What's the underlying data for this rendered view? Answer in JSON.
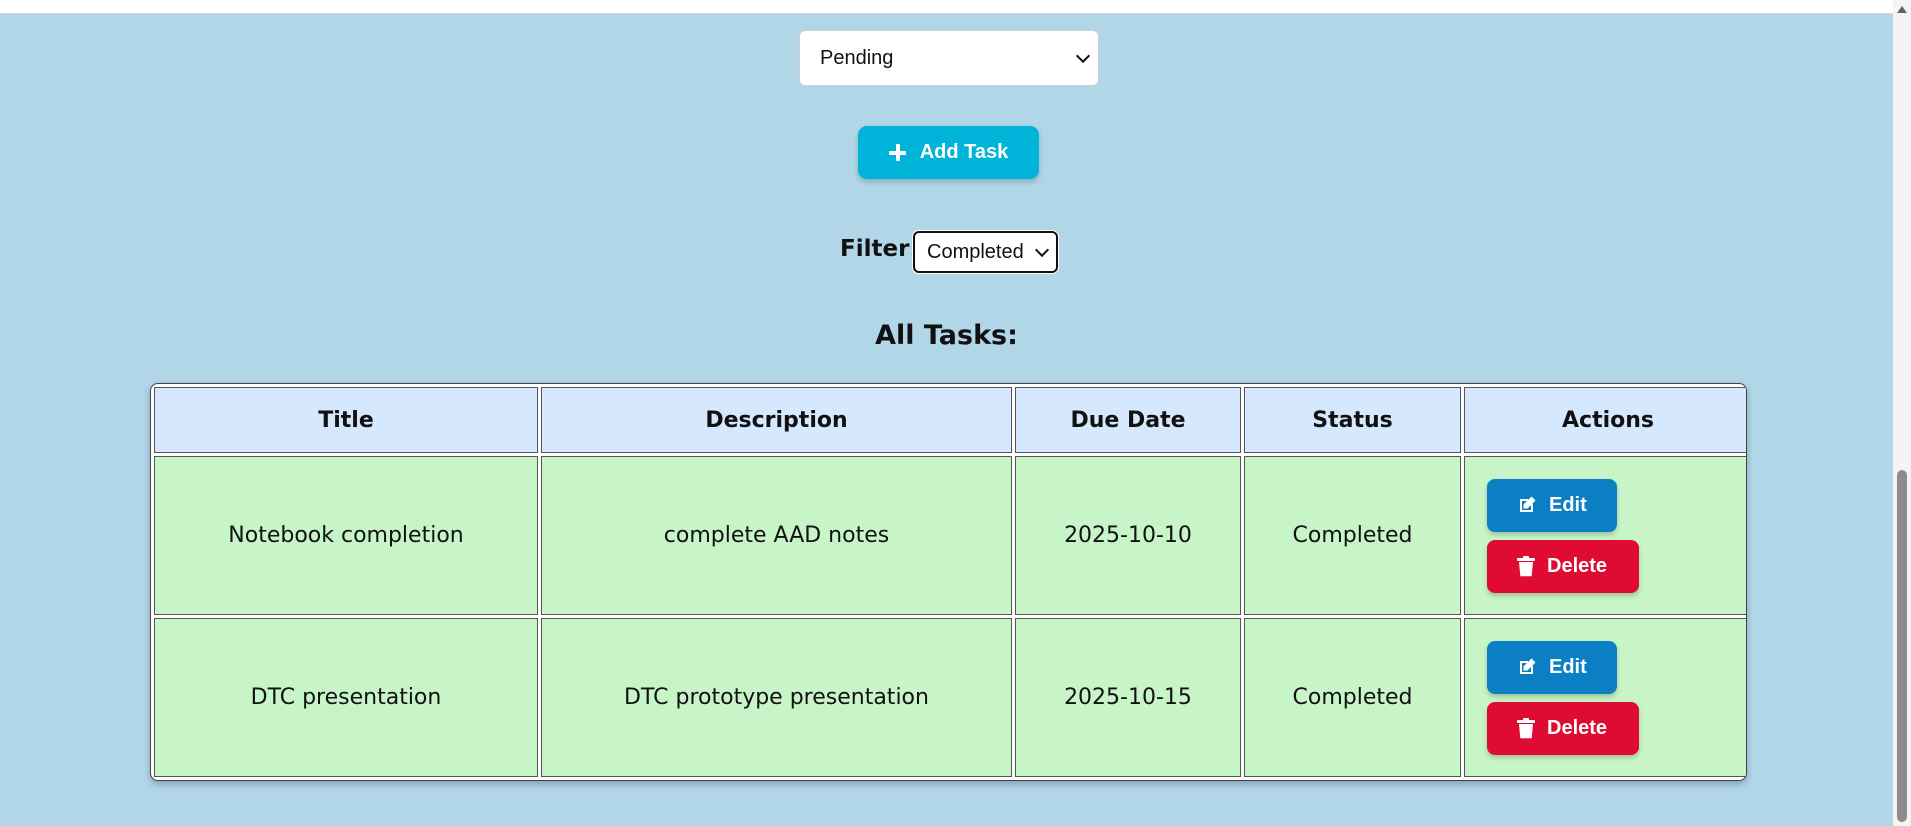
{
  "task_form": {
    "status_value": "Pending",
    "add_task_label": "Add Task"
  },
  "filter": {
    "label": "Filter:",
    "value": "Completed"
  },
  "section_title": "All Tasks:",
  "table": {
    "headers": [
      "Title",
      "Description",
      "Due Date",
      "Status",
      "Actions"
    ],
    "rows": [
      {
        "title": "Notebook completion",
        "description": "complete AAD notes",
        "due_date": "2025-10-10",
        "status": "Completed",
        "edit_label": "Edit",
        "delete_label": "Delete"
      },
      {
        "title": "DTC presentation",
        "description": "DTC prototype presentation",
        "due_date": "2025-10-15",
        "status": "Completed",
        "edit_label": "Edit",
        "delete_label": "Delete"
      }
    ]
  },
  "icons": {
    "add": "plus-icon",
    "edit": "edit-icon",
    "delete": "trash-icon"
  },
  "colors": {
    "page_background": "#b0d6e8",
    "add_button": "#00b3d9",
    "edit_button": "#0a7fc4",
    "delete_button": "#df0b32",
    "header_cell": "#d6e8fd",
    "row_cell": "#c7f5c8"
  }
}
